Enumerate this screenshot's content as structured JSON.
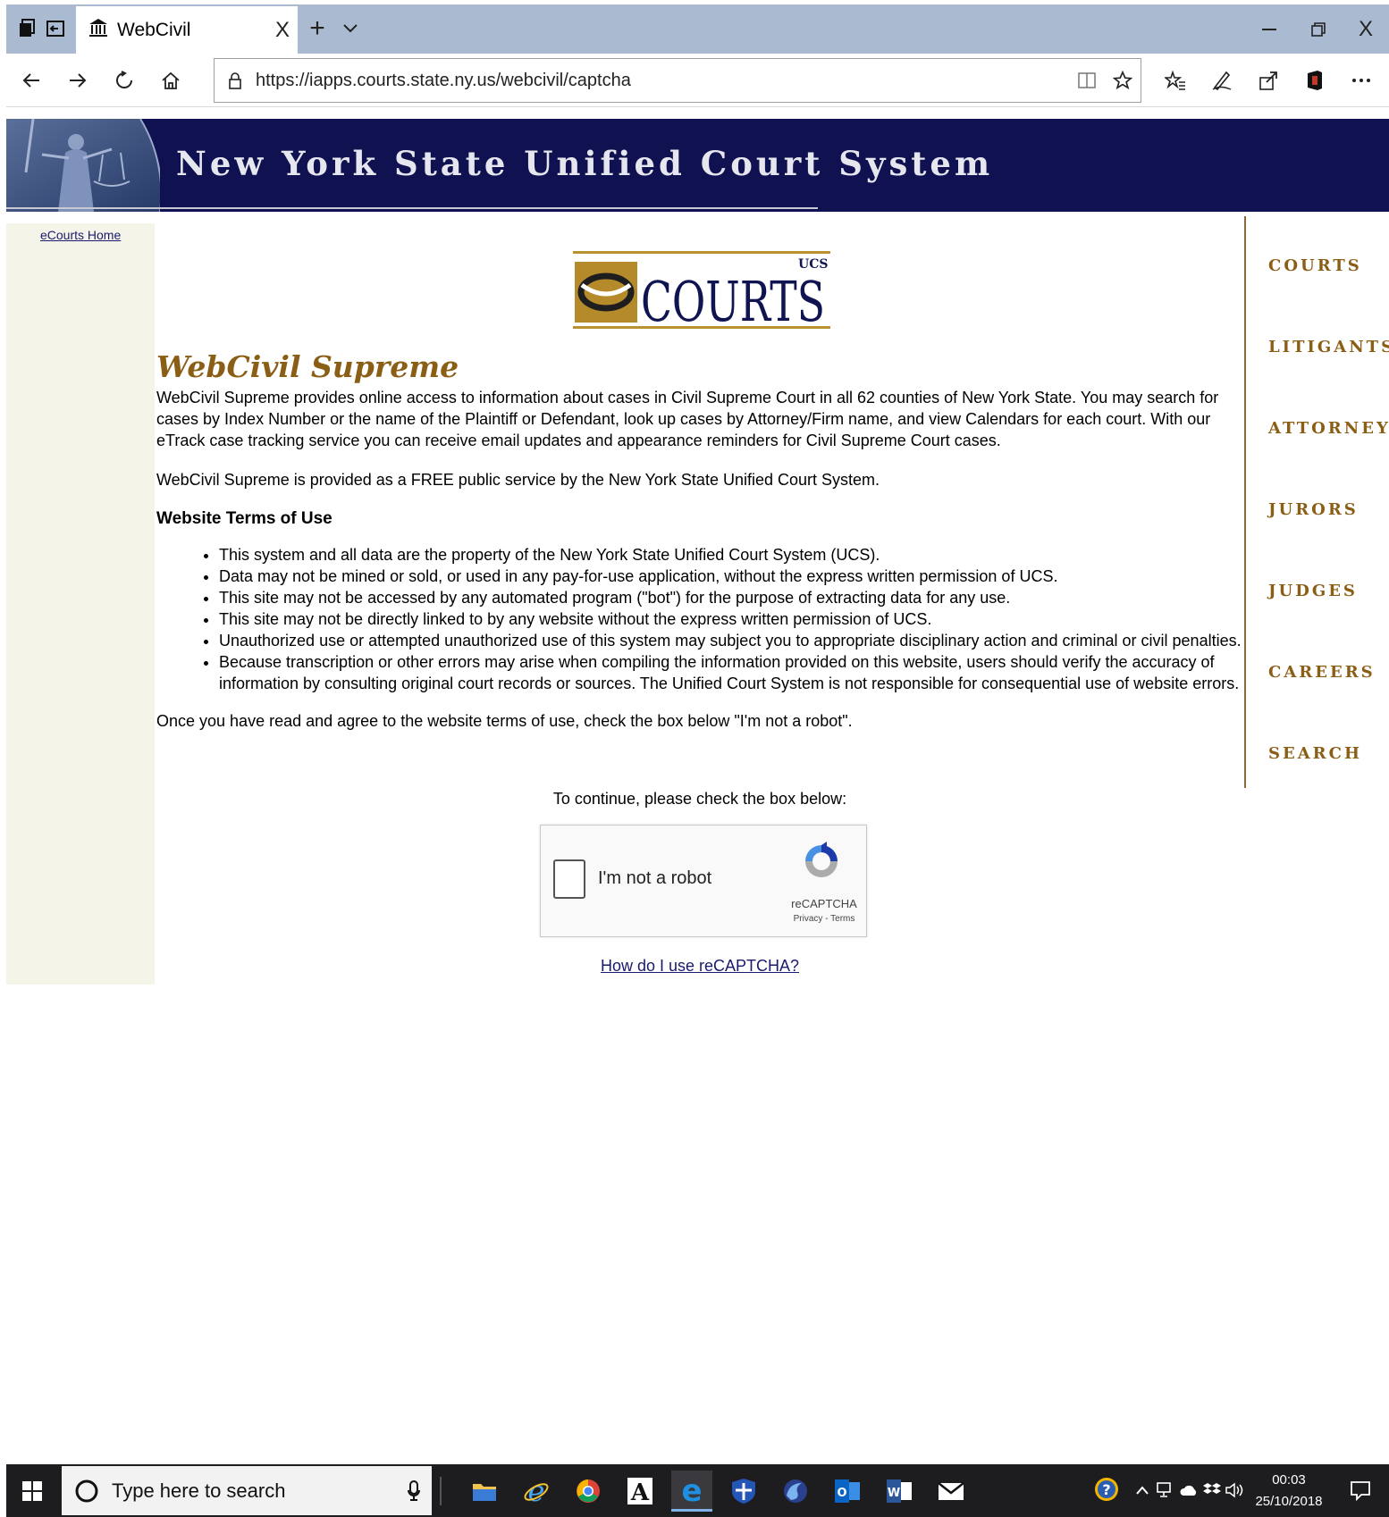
{
  "browser": {
    "tab": {
      "title": "WebCivil",
      "close": "X"
    },
    "new_tab": "+",
    "address": "https://iapps.courts.state.ny.us/webcivil/captcha",
    "window_close": "X"
  },
  "banner": {
    "title": "New York State Unified Court System"
  },
  "left_nav": {
    "ecourts_home": "eCourts Home"
  },
  "right_nav": [
    "COURTS",
    "LITIGANTS",
    "ATTORNEYS",
    "JURORS",
    "JUDGES",
    "CAREERS",
    "SEARCH"
  ],
  "logo": {
    "brand": "COURTS",
    "sup": "UCS"
  },
  "main": {
    "heading": "WebCivil Supreme",
    "intro": "WebCivil Supreme provides online access to information about cases in Civil Supreme Court in all 62 counties of New York State. You may search for cases by Index Number or the name of the Plaintiff or Defendant, look up cases by Attorney/Firm name, and view Calendars for each court. With our eTrack case tracking service you can receive email updates and appearance reminders for Civil Supreme Court cases.",
    "free_service": "WebCivil Supreme  is provided as a FREE public service by the New York State Unified Court System.",
    "terms_heading": "Website Terms of Use",
    "terms": [
      "This system and all data are the property of the New York State Unified Court System (UCS).",
      "Data may not be mined or sold, or used in any pay-for-use application, without the express written permission of UCS.",
      "This site may not be accessed by any automated program (\"bot\") for the purpose of extracting data for any use.",
      "This site may not be directly linked to by any website without the express written permission of UCS.",
      "Unauthorized use or attempted unauthorized use of this system may subject you to appropriate disciplinary action and criminal or civil penalties.",
      "Because transcription or other errors may arise when compiling the information provided on this website, users should verify the accuracy of information by consulting original court records or sources. The Unified Court System is not responsible for consequential use of website errors."
    ],
    "agree_text": "Once you have read and agree to the website terms of use, check the box below \"I'm not a robot\".",
    "continue_text": "To continue, please check the box below:",
    "captcha": {
      "label": "I'm not a robot",
      "brand": "reCAPTCHA",
      "links": "Privacy - Terms"
    },
    "howto_link": "How do I use reCAPTCHA?"
  },
  "taskbar": {
    "search_placeholder": "Type here to search",
    "time": "00:03",
    "date": "25/10/2018",
    "apps": [
      "file-explorer",
      "internet-explorer",
      "chrome",
      "font-app",
      "edge",
      "shield-app",
      "firefox",
      "outlook",
      "word",
      "mail"
    ]
  }
}
